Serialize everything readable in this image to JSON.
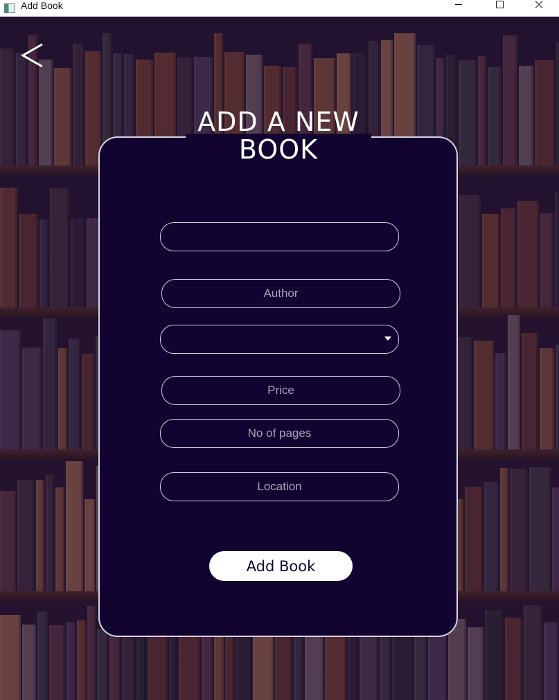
{
  "window": {
    "title": "Add Book",
    "controls": [
      "minimize",
      "maximize",
      "close"
    ]
  },
  "header": {
    "back_icon": "chevron-left-icon",
    "title": "ADD A NEW\nBOOK"
  },
  "form": {
    "title_field": {
      "value": "",
      "placeholder": ""
    },
    "author_field": {
      "value": "",
      "placeholder": "Author"
    },
    "category_select": {
      "selected": ""
    },
    "price_field": {
      "value": "",
      "placeholder": "Price"
    },
    "pages_field": {
      "value": "",
      "placeholder": "No of pages"
    },
    "location_field": {
      "value": "",
      "placeholder": "Location"
    },
    "submit_label": "Add Book"
  },
  "colors": {
    "card_background": "#110431",
    "card_border": "#d9d4e3",
    "field_border": "#d4cde0",
    "placeholder_text": "#a9a4b8",
    "button_background": "#ffffff",
    "button_text": "#110431"
  }
}
